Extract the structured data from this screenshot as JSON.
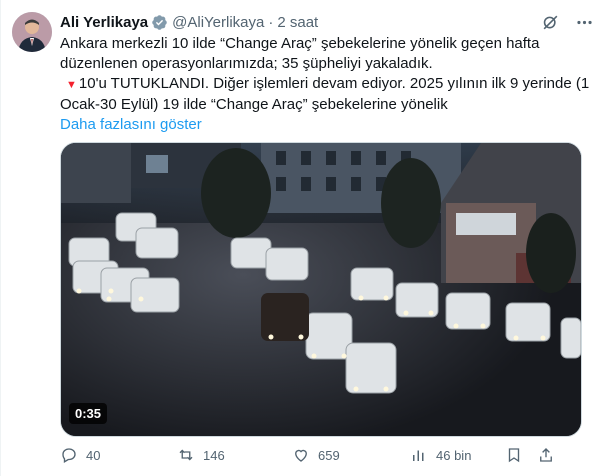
{
  "author": {
    "name": "Ali Yerlikaya",
    "handle": "@AliYerlikaya",
    "separator": "·",
    "time": "2 saat"
  },
  "tweet": {
    "line1": "Ankara merkezli 10 ilde “Change Araç” şebekelerine yönelik geçen hafta düzenlenen operasyonlarımızda; 35 şüpheliyi yakaladık.",
    "line2": "10'u TUTUKLANDI. Diğer işlemleri devam ediyor. 2025 yılının ilk 9 yerinde (1 Ocak-30 Eylül) 19 ilde “Change Araç” şebekelerine yönelik",
    "show_more": "Daha fazlasını göster"
  },
  "video": {
    "duration": "0:35"
  },
  "actions": {
    "replies": "40",
    "reposts": "146",
    "likes": "659",
    "views": "46 bin"
  },
  "colors": {
    "accent": "#1d9bf0",
    "verified": "#829aab",
    "text_secondary": "#536471",
    "alert_triangle": "#f4212e"
  },
  "icons": [
    "verified-badge-icon",
    "grok-icon",
    "more-icon",
    "reply-icon",
    "repost-icon",
    "like-icon",
    "views-icon",
    "bookmark-icon",
    "share-icon"
  ]
}
